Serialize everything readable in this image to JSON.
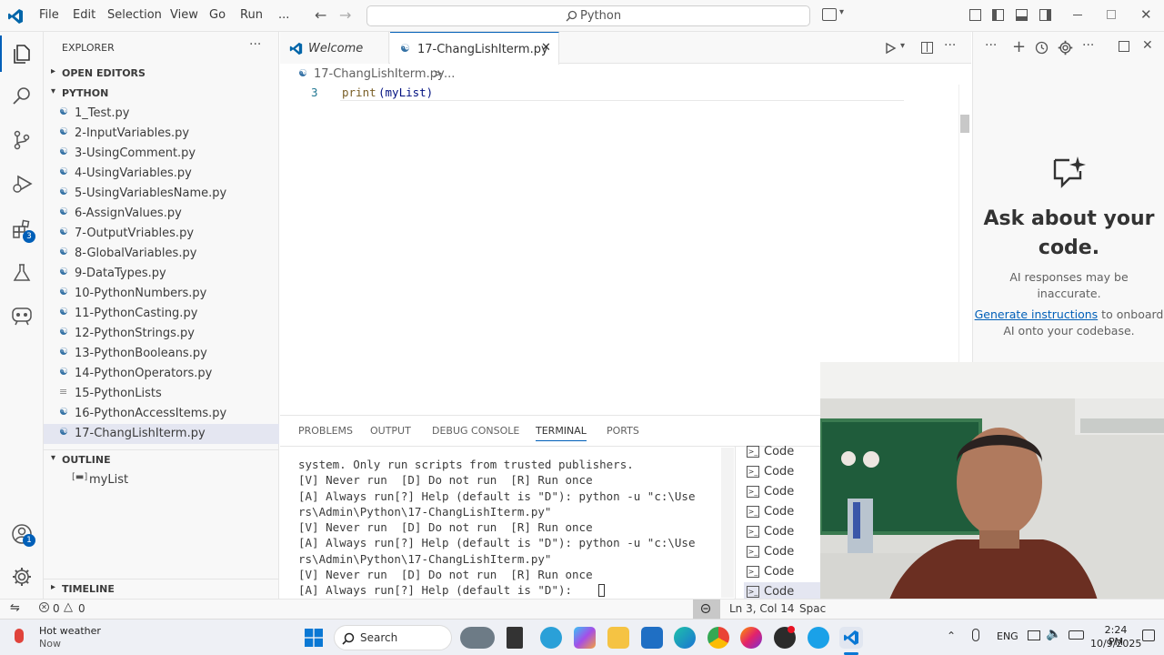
{
  "titlebar": {
    "menus": [
      "File",
      "Edit",
      "Selection",
      "View",
      "Go",
      "Run",
      "..."
    ],
    "search_text": "Python"
  },
  "activitybar": {
    "extensions_badge": "3",
    "accounts_badge": "1"
  },
  "explorer": {
    "header": "EXPLORER",
    "more": "···",
    "open_editors": "OPEN EDITORS",
    "folder": "PYTHON",
    "files": [
      "1_Test.py",
      "2-InputVariables.py",
      "3-UsingComment.py",
      "4-UsingVariables.py",
      "5-UsingVariablesName.py",
      "6-AssignValues.py",
      "7-OutputVriables.py",
      "8-GlobalVariables.py",
      "9-DataTypes.py",
      "10-PythonNumbers.py",
      "11-PythonCasting.py",
      "12-PythonStrings.py",
      "13-PythonBooleans.py",
      "14-PythonOperators.py",
      "15-PythonLists",
      "16-PythonAccessItems.py",
      "17-ChangLishIterm.py"
    ],
    "outline": "OUTLINE",
    "outline_item": "myList",
    "timeline": "TIMELINE"
  },
  "tabs": [
    {
      "label": "Welcome"
    },
    {
      "label": "17-ChangLishIterm.py"
    }
  ],
  "breadcrumb": {
    "file": "17-ChangLishIterm.py",
    "sep": ">",
    "rest": "..."
  },
  "editor": {
    "line_number": "3",
    "code_fn": "print",
    "code_arg": "(myList)"
  },
  "chat": {
    "title": "Ask about your code.",
    "disclaimer": "AI responses may be inaccurate.",
    "link": "Generate instructions",
    "link_rest": "to onboard AI onto your codebase."
  },
  "panel": {
    "tabs": [
      "PROBLEMS",
      "OUTPUT",
      "DEBUG CONSOLE",
      "TERMINAL",
      "PORTS"
    ],
    "terminal_lines": [
      "system. Only run scripts from trusted publishers.",
      "[V] Never run  [D] Do not run  [R] Run once",
      "[A] Always run[?] Help (default is \"D\"): python -u \"c:\\Use",
      "rs\\Admin\\Python\\17-ChangLishIterm.py\"",
      "[V] Never run  [D] Do not run  [R] Run once",
      "[A] Always run[?] Help (default is \"D\"): python -u \"c:\\Use",
      "rs\\Admin\\Python\\17-ChangLishIterm.py\"",
      "[V] Never run  [D] Do not run  [R] Run once",
      "[A] Always run[?] Help (default is \"D\"): "
    ],
    "terminal_list": [
      "Code",
      "Code",
      "Code",
      "Code",
      "Code",
      "Code",
      "Code",
      "Code"
    ]
  },
  "statusbar": {
    "errors": "0",
    "warnings": "0",
    "position": "Ln 3, Col 14",
    "spaces": "Spac"
  },
  "taskbar": {
    "weather_title": "Hot weather",
    "weather_sub": "Now",
    "search": "Search",
    "lang": "ENG",
    "time": "2:24 PM",
    "date": "10/9/2025"
  },
  "colors": {
    "accent": "#005fb8",
    "python_icon": "#3572a5"
  }
}
